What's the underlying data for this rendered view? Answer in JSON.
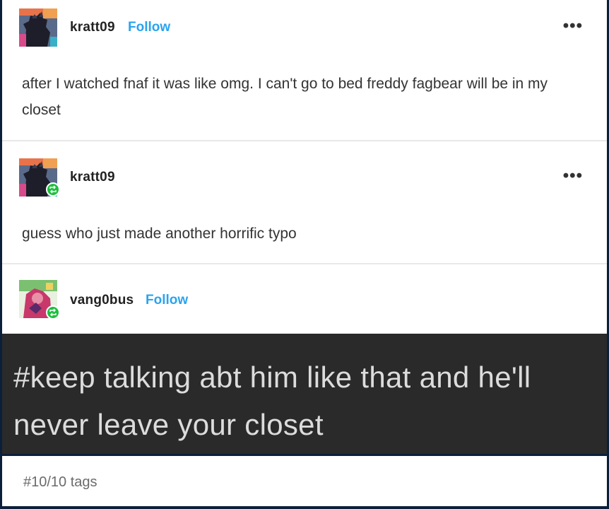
{
  "posts": [
    {
      "username": "kratt09",
      "follow_label": "Follow",
      "more_label": "•••",
      "text": "after I watched fnaf it was like omg. I can't go to bed freddy fagbear will be in my closet"
    },
    {
      "username": "kratt09",
      "more_label": "•••",
      "text": "guess who just made another horrific typo"
    },
    {
      "username": "vang0bus",
      "follow_label": "Follow"
    }
  ],
  "tag_band": {
    "text": "#keep talking abt him like that and he'll never leave your closet"
  },
  "tags": [
    "#10/10 tags"
  ],
  "colors": {
    "follow": "#2aa3ef",
    "reblog_badge": "#1fbf3f",
    "tag_band_bg": "#2a2a2a"
  },
  "icons": {
    "reblog_badge": "reblog-icon",
    "more": "more-options-icon"
  }
}
